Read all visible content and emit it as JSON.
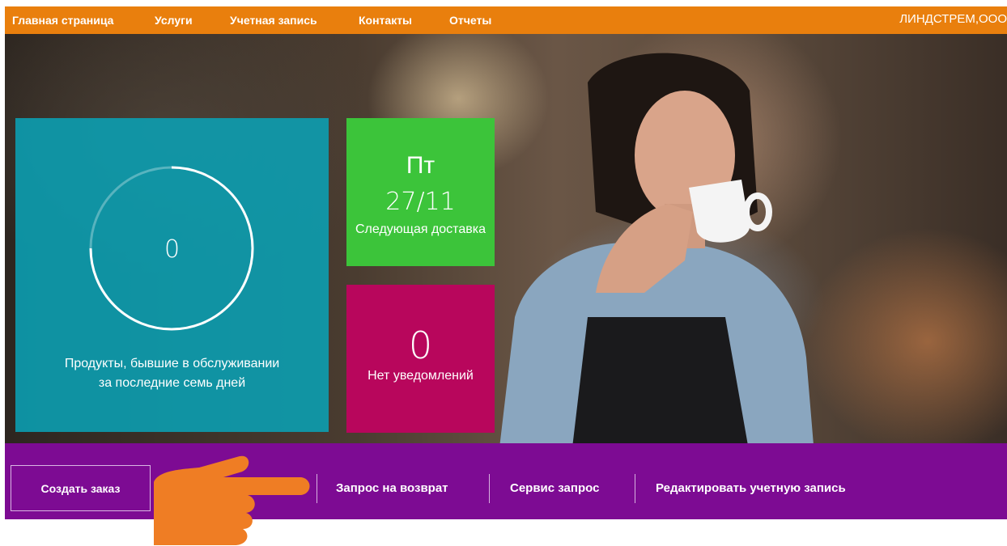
{
  "topnav": {
    "items": [
      {
        "label": "Главная страница"
      },
      {
        "label": "Услуги"
      },
      {
        "label": "Учетная запись"
      },
      {
        "label": "Контакты"
      },
      {
        "label": "Отчеты"
      }
    ],
    "account_name": "ЛИНДСТРЕМ,ООО"
  },
  "tiles": {
    "products": {
      "value": "0",
      "label": "Продукты, бывшие в обслуживании за последние семь дней"
    },
    "delivery": {
      "day": "Пт",
      "date": "27/11",
      "label": "Следующая доставка"
    },
    "notifications": {
      "value": "0",
      "label": "Нет уведомлений"
    }
  },
  "actions": {
    "create_order": "Создать заказ",
    "return_request": "Запрос на возврат",
    "service_request": "Сервис запрос",
    "edit_account": "Редактировать учетную запись"
  },
  "colors": {
    "nav_orange": "#e97f0d",
    "tile_teal": "#0aa0b4",
    "tile_green": "#3cc43a",
    "tile_pink": "#b8065c",
    "action_purple": "#7d0b93",
    "hand_orange": "#ef7d24"
  },
  "icons": {
    "pointer": "pointing-hand-icon"
  }
}
